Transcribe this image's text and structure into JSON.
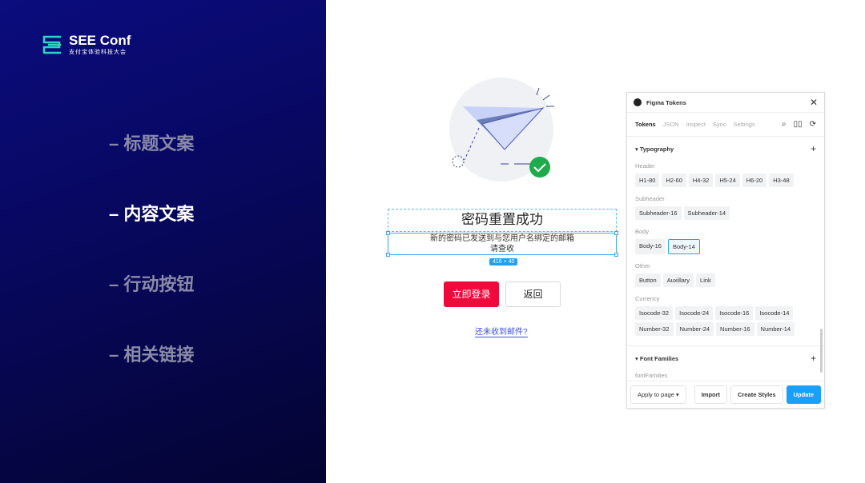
{
  "brand": {
    "name": "SEE Conf",
    "subtitle": "支付宝体验科技大会",
    "accent": "#2ed3c6"
  },
  "menu": [
    {
      "label": "– 标题文案",
      "active": false
    },
    {
      "label": "– 内容文案",
      "active": true
    },
    {
      "label": "– 行动按钮",
      "active": false
    },
    {
      "label": "– 相关链接",
      "active": false
    }
  ],
  "canvas": {
    "title": "密码重置成功",
    "body_line1": "新的密码已发送到与您用户名绑定的邮箱",
    "body_line2": "请查收",
    "dimension": "416 × 40",
    "login_button": "立即登录",
    "back_button": "返回",
    "link": "还未收到邮件?"
  },
  "plugin": {
    "title": "Figma Tokens",
    "tabs": [
      "Tokens",
      "JSON",
      "Inspect",
      "Sync",
      "Settings"
    ],
    "sections": [
      {
        "title": "Typography",
        "groups": [
          {
            "name": "Header",
            "tokens": [
              "H1-80",
              "H2-60",
              "H4-32",
              "H5-24",
              "H6-20",
              "H3-48"
            ]
          },
          {
            "name": "Subheader",
            "tokens": [
              "Subheader-16",
              "Subheader-14"
            ]
          },
          {
            "name": "Body",
            "tokens": [
              "Body-16",
              "Body-14"
            ],
            "selected": "Body-14"
          },
          {
            "name": "Other",
            "tokens": [
              "Button",
              "Auxillary",
              "Link"
            ]
          },
          {
            "name": "Currency",
            "tokens": [
              "Isocode-32",
              "Isocode-24",
              "Isocode-16",
              "Isocode-14",
              "Number-32",
              "Number-24",
              "Number-16",
              "Number-14"
            ]
          }
        ]
      },
      {
        "title": "Font Families",
        "groups": [
          {
            "name": "fontFamilies",
            "tokens": []
          }
        ]
      }
    ],
    "footer": {
      "apply": "Apply to page",
      "import": "Import",
      "create": "Create Styles",
      "update": "Update"
    }
  }
}
